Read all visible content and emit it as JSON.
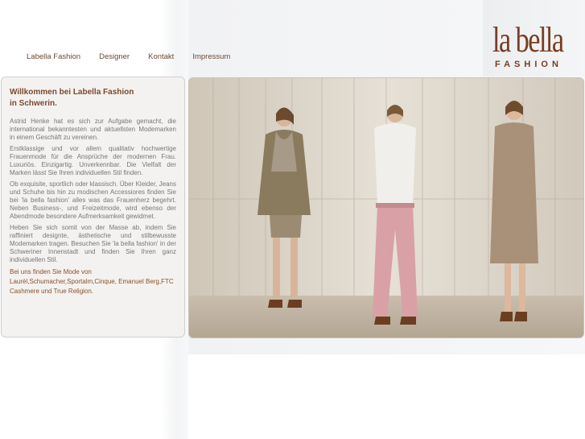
{
  "nav": {
    "items": [
      {
        "label": "Labella Fashion"
      },
      {
        "label": "Designer"
      },
      {
        "label": "Kontakt"
      },
      {
        "label": "Impressum"
      }
    ]
  },
  "logo": {
    "main": "la bella",
    "sub": "FASHION"
  },
  "intro": {
    "title_line1": "Willkommen bei Labella Fashion",
    "title_line2": "in Schwerin.",
    "paragraphs": [
      "Astrid Henke hat es sich zur Aufgabe gemacht, die international bekanntesten und aktuellsten Modemarken in einem Geschäft zu vereinen.",
      "Erstklassige und vor allem qualitativ hochwertige Frauenmode für die Ansprüche der modernen Frau. Luxuriös. Einzigartig. Unverkennbar. Die Vielfalt der Marken lässt Sie Ihren individuellen Stil finden.",
      "Ob exquisite, sportlich oder klassisch. Über Kleider, Jeans und Schuhe bis hin zu modischen Accessiores finden Sie bei 'la bella fashion' alles was das Frauenherz begehrt. Neben Business-, und Freizeitmode, wird ebenso der Abendmode besondere Aufmerksamkeit gewidmet.",
      "Heben Sie sich somit von der Masse ab, indem Sie raffiniert designte, ästhetische und stilbewusste Modemarken tragen. Besuchen Sie 'la bella fashion' in der Schweriner Innenstadt und finden Sie Ihren ganz individuellen Stil."
    ],
    "brands": "Bei uns finden Sie Mode von Laurèl,Schumacher,Sportalm,Cinque, Emanuel Berg,FTC Cashmere und True Religion."
  },
  "colors": {
    "accent": "#7a3d22",
    "nav_text": "#6a4a36",
    "panel_bg": "#f4f2f0"
  }
}
